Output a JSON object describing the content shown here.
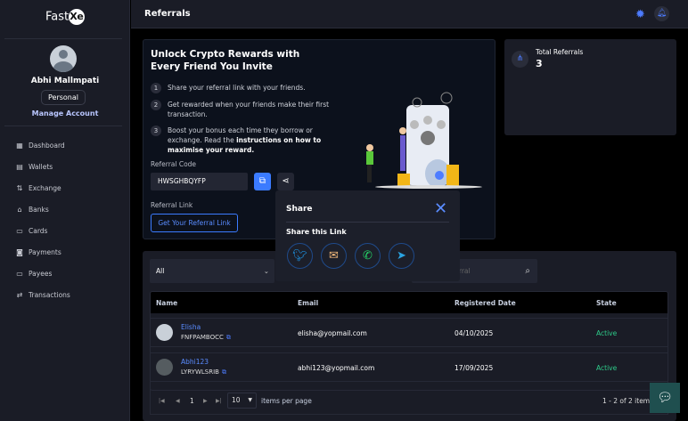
{
  "brand": {
    "name": "Fast",
    "mark": "Xe"
  },
  "user": {
    "name": "Abhi Mallmpati",
    "account_type": "Personal",
    "manage_label": "Manage Account"
  },
  "sidebar": {
    "items": [
      {
        "label": "Dashboard",
        "icon": "dashboard-icon"
      },
      {
        "label": "Wallets",
        "icon": "wallet-icon"
      },
      {
        "label": "Exchange",
        "icon": "exchange-icon"
      },
      {
        "label": "Banks",
        "icon": "bank-icon"
      },
      {
        "label": "Cards",
        "icon": "cards-icon"
      },
      {
        "label": "Payments",
        "icon": "payments-icon"
      },
      {
        "label": "Payees",
        "icon": "payees-icon"
      },
      {
        "label": "Transactions",
        "icon": "transactions-icon"
      }
    ]
  },
  "header": {
    "title": "Referrals"
  },
  "promo": {
    "title": "Unlock Crypto Rewards with Every Friend You Invite",
    "steps": [
      {
        "n": "1",
        "text": "Share your referral link with your friends."
      },
      {
        "n": "2",
        "text": "Get rewarded when your friends make their first transaction."
      },
      {
        "n": "3",
        "text": "Boost your bonus each time they borrow or exchange. Read the ",
        "bold": "instructions on how to maximise your reward."
      }
    ],
    "code_label": "Referral Code",
    "code": "HWSGHBQYFP",
    "link_label": "Referral Link",
    "link_button": "Get Your Referral Link"
  },
  "total": {
    "label": "Total Referrals",
    "value": "3"
  },
  "filter": {
    "selected": "All",
    "search_placeholder": "Search Referral"
  },
  "table": {
    "columns": [
      "Name",
      "Email",
      "Registered Date",
      "State"
    ],
    "rows": [
      {
        "name": "Elisha",
        "code": "FNFPAMBOCC",
        "email": "elisha@yopmail.com",
        "date": "04/10/2025",
        "state": "Active"
      },
      {
        "name": "Abhi123",
        "code": "LYRYWLSRIB",
        "email": "abhi123@yopmail.com",
        "date": "17/09/2025",
        "state": "Active"
      }
    ]
  },
  "pagination": {
    "page": "1",
    "per_page": "10",
    "per_page_label": "items per page",
    "range": "1 - 2 of 2 items"
  },
  "share": {
    "title": "Share",
    "subtitle": "Share this Link",
    "targets": [
      "twitter",
      "email",
      "whatsapp",
      "telegram"
    ]
  },
  "colors": {
    "accent": "#3b7bff",
    "active": "#2ecc8a",
    "sidebar": "#1a1c26"
  }
}
